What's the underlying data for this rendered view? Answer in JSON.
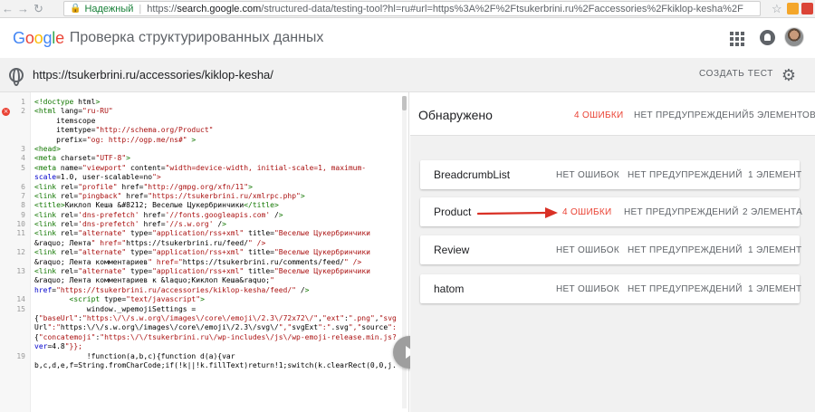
{
  "browser": {
    "secure_label": "Надежный",
    "url_prefix": "https://",
    "url_host": "search.google.com",
    "url_rest": "/structured-data/testing-tool?hl=ru#url=https%3A%2F%2Ftsukerbrini.ru%2Faccessories%2Fkiklop-kesha%2F"
  },
  "app": {
    "logo": [
      "G",
      "o",
      "o",
      "g",
      "l",
      "e"
    ],
    "title": "Проверка структурированных данных"
  },
  "urlbar": {
    "tested_url": "https://tsukerbrini.ru/accessories/kiklop-kesha/",
    "new_test": "СОЗДАТЬ ТЕСТ"
  },
  "code": {
    "lines": [
      {
        "n": "1",
        "text": "<!doctype html>",
        "err": false
      },
      {
        "n": "2",
        "text": "<html lang=\"ru-RU\"",
        "err": true
      },
      {
        "n": "",
        "text": "     itemscope",
        "err": false
      },
      {
        "n": "",
        "text": "     itemtype=\"http://schema.org/Product\"",
        "err": false
      },
      {
        "n": "",
        "text": "     prefix=\"og: http://ogp.me/ns#\" >",
        "err": false
      },
      {
        "n": "3",
        "text": "<head>",
        "err": false
      },
      {
        "n": "4",
        "text": "<meta charset=\"UTF-8\">",
        "err": false
      },
      {
        "n": "5",
        "text": "<meta name=\"viewport\" content=\"width=device-width, initial-scale=1, maximum-",
        "err": false
      },
      {
        "n": "",
        "text": "scale=1.0, user-scalable=no\">",
        "err": false
      },
      {
        "n": "6",
        "text": "<link rel=\"profile\" href=\"http://gmpg.org/xfn/11\">",
        "err": false
      },
      {
        "n": "7",
        "text": "<link rel=\"pingback\" href=\"https://tsukerbrini.ru/xmlrpc.php\">",
        "err": false
      },
      {
        "n": "8",
        "text": "<title>Киклоп Кеша &#8212; Веселые Цукербринчики</title>",
        "err": false
      },
      {
        "n": "9",
        "text": "<link rel='dns-prefetch' href='//fonts.googleapis.com' />",
        "err": false
      },
      {
        "n": "10",
        "text": "<link rel='dns-prefetch' href='//s.w.org' />",
        "err": false
      },
      {
        "n": "11",
        "text": "<link rel=\"alternate\" type=\"application/rss+xml\" title=\"Веселые Цукербринчики",
        "err": false
      },
      {
        "n": "",
        "text": "&raquo; Лента\" href=\"https://tsukerbrini.ru/feed/\" />",
        "err": false
      },
      {
        "n": "12",
        "text": "<link rel=\"alternate\" type=\"application/rss+xml\" title=\"Веселые Цукербринчики",
        "err": false
      },
      {
        "n": "",
        "text": "&raquo; Лента комментариев\" href=\"https://tsukerbrini.ru/comments/feed/\" />",
        "err": false
      },
      {
        "n": "13",
        "text": "<link rel=\"alternate\" type=\"application/rss+xml\" title=\"Веселые Цукербринчики",
        "err": false
      },
      {
        "n": "",
        "text": "&raquo; Лента комментариев к &laquo;Киклоп Кеша&raquo;\"",
        "err": false
      },
      {
        "n": "",
        "text": "href=\"https://tsukerbrini.ru/accessories/kiklop-kesha/feed/\" />",
        "err": false
      },
      {
        "n": "14",
        "text": "        <script type=\"text/javascript\">",
        "err": false
      },
      {
        "n": "15",
        "text": "            window._wpemojiSettings =",
        "err": false
      },
      {
        "n": "",
        "text": "{\"baseUrl\":\"https:\\/\\/s.w.org\\/images\\/core\\/emoji\\/2.3\\/72x72\\/\",\"ext\":\".png\",\"svg",
        "err": false
      },
      {
        "n": "",
        "text": "Url\":\"https:\\/\\/s.w.org\\/images\\/core\\/emoji\\/2.3\\/svg\\/\",\"svgExt\":\".svg\",\"source\":",
        "err": false
      },
      {
        "n": "",
        "text": "{\"concatemoji\":\"https:\\/\\/tsukerbrini.ru\\/wp-includes\\/js\\/wp-emoji-release.min.js?",
        "err": false
      },
      {
        "n": "",
        "text": "ver=4.8\"}};",
        "err": false
      },
      {
        "n": "19",
        "text": "            !function(a,b,c){function d(a){var",
        "err": false
      },
      {
        "n": "",
        "text": "b,c,d,e,f=String.fromCharCode;if(!k||!k.fillText)return!1;switch(k.clearRect(0,0,j.",
        "err": false
      }
    ]
  },
  "results": {
    "summary": {
      "title": "Обнаружено",
      "errors": "4 ОШИБКИ",
      "warnings": "НЕТ ПРЕДУПРЕЖДЕНИЙ",
      "items": "5 ЭЛЕМЕНТОВ"
    },
    "cards": [
      {
        "name": "BreadcrumbList",
        "errors": "НЕТ ОШИБОК",
        "warnings": "НЕТ ПРЕДУПРЕЖДЕНИЙ",
        "items": "1 ЭЛЕМЕНТ",
        "has_errors": false
      },
      {
        "name": "Product",
        "errors": "4 ОШИБКИ",
        "warnings": "НЕТ ПРЕДУПРЕЖДЕНИЙ",
        "items": "2 ЭЛЕМЕНТА",
        "has_errors": true
      },
      {
        "name": "Review",
        "errors": "НЕТ ОШИБОК",
        "warnings": "НЕТ ПРЕДУПРЕЖДЕНИЙ",
        "items": "1 ЭЛЕМЕНТ",
        "has_errors": false
      },
      {
        "name": "hatom",
        "errors": "НЕТ ОШИБОК",
        "warnings": "НЕТ ПРЕДУПРЕЖДЕНИЙ",
        "items": "1 ЭЛЕМЕНТ",
        "has_errors": false
      }
    ]
  },
  "colors": {
    "error_red": "#ea4335",
    "annotation_arrow": "#d93025",
    "panel_bg": "#f1f1f1",
    "text_secondary": "#5f6368"
  },
  "icons": [
    "back-icon",
    "forward-icon",
    "reload-icon",
    "lock-icon",
    "star-icon",
    "apps-icon",
    "notifications-icon",
    "globe-icon",
    "settings-icon",
    "error-icon",
    "play-icon"
  ]
}
